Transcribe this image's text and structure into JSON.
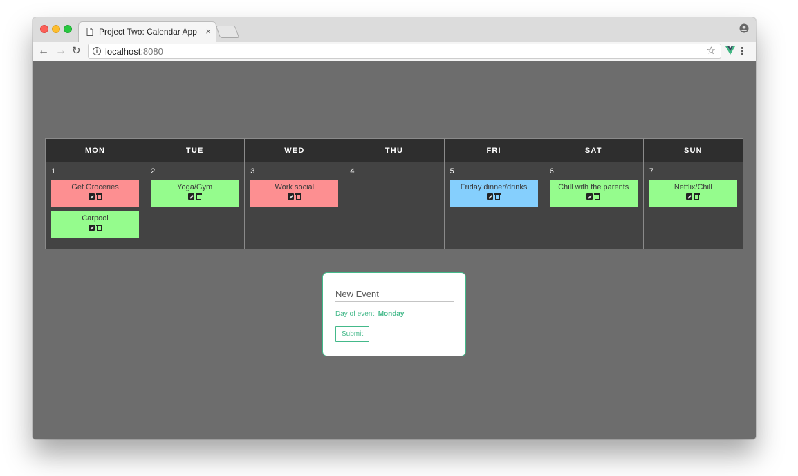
{
  "browser": {
    "tab_title": "Project Two: Calendar App",
    "tab_close": "×",
    "url_host": "localhost",
    "url_port": ":8080",
    "info_glyph": "i"
  },
  "calendar": {
    "days": [
      {
        "name": "MON",
        "number": "1",
        "events": [
          {
            "title": "Get Groceries",
            "color": "#fd8f91"
          },
          {
            "title": "Carpool",
            "color": "#95fc8d"
          }
        ]
      },
      {
        "name": "TUE",
        "number": "2",
        "events": [
          {
            "title": "Yoga/Gym",
            "color": "#95fc8d"
          }
        ]
      },
      {
        "name": "WED",
        "number": "3",
        "events": [
          {
            "title": "Work social",
            "color": "#fd8f91"
          }
        ]
      },
      {
        "name": "THU",
        "number": "4",
        "events": []
      },
      {
        "name": "FRI",
        "number": "5",
        "events": [
          {
            "title": "Friday dinner/drinks",
            "color": "#85cffd"
          }
        ]
      },
      {
        "name": "SAT",
        "number": "6",
        "events": [
          {
            "title": "Chill with the parents",
            "color": "#95fc8d"
          }
        ]
      },
      {
        "name": "SUN",
        "number": "7",
        "events": [
          {
            "title": "Netflix/Chill",
            "color": "#95fc8d"
          }
        ]
      }
    ]
  },
  "new_event": {
    "placeholder": "New Event",
    "day_label": "Day of event:",
    "day_value": "Monday",
    "submit_label": "Submit",
    "accent": "#44b98a"
  }
}
